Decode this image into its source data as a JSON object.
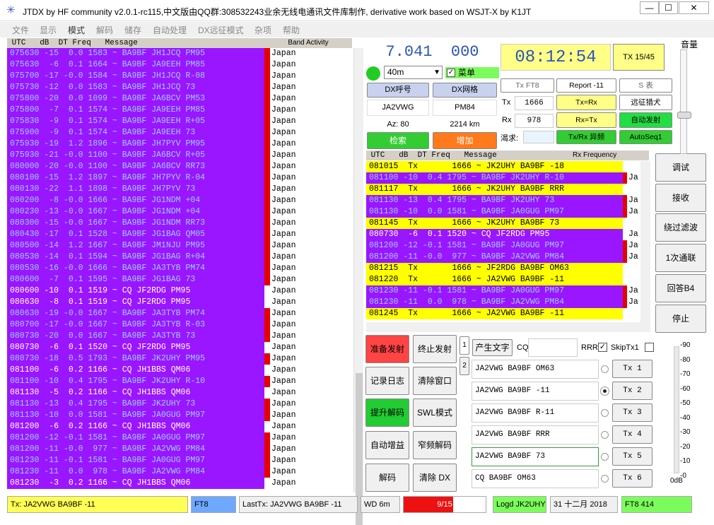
{
  "window": {
    "app_name": "JTDX",
    "title": "JTDX  by HF community         v2.0.1-rc115,中文版由QQ群:308532243业余无线电通讯文件库制作, derivative work based on WSJT-X by K1JT",
    "min_label": "—",
    "max_label": "☐",
    "close_label": "✕"
  },
  "menu": [
    "文件",
    "显示",
    "模式",
    "解码",
    "储存",
    "自动处理",
    "DX远征模式",
    "杂项",
    "帮助"
  ],
  "band_activity": {
    "header": " UTC   dB  DT Freq   Message",
    "header_right": "Band Activity",
    "colors": {
      "purple": "#9a16ff",
      "white": "#ffffff",
      "red": "#e80000",
      "text_purple": "#ffffff"
    },
    "rows": [
      {
        "t": "075630 -15  0.0 1583 ~ BA9BF JH1JCQ PM95",
        "c": "Japan",
        "bg": "purple",
        "bar": "red"
      },
      {
        "t": "075630  -6  0.1 1664 ~ BA9BF JA9EEH PM85",
        "c": "Japan",
        "bg": "purple",
        "bar": "red"
      },
      {
        "t": "075700 -17 -0.0 1584 ~ BA9BF JH1JCQ R-08",
        "c": "Japan",
        "bg": "purple",
        "bar": "red"
      },
      {
        "t": "075730 -12  0.0 1583 ~ BA9BF JH1JCQ 73",
        "c": "Japan",
        "bg": "purple",
        "bar": "red"
      },
      {
        "t": "075800 -20  0.0 1099 ~ BA9BF JA6BCV PM53",
        "c": "Japan",
        "bg": "purple",
        "bar": "red"
      },
      {
        "t": "075800  -7  0.1 1574 ~ BA9BF JA9EEH PM85",
        "c": "Japan",
        "bg": "purple",
        "bar": "red"
      },
      {
        "t": "075830  -9  0.1 1574 ~ BA9BF JA9EEH R+05",
        "c": "Japan",
        "bg": "purple",
        "bar": "red"
      },
      {
        "t": "075900  -9  0.1 1574 ~ BA9BF JA9EEH 73",
        "c": "Japan",
        "bg": "purple",
        "bar": "red"
      },
      {
        "t": "075930 -19  1.2 1896 ~ BA9BF JH7PYV PM95",
        "c": "Japan",
        "bg": "purple",
        "bar": "red"
      },
      {
        "t": "075930 -21 -0.0 1100 ~ BA9BF JA6BCV R+05",
        "c": "Japan",
        "bg": "purple",
        "bar": "red"
      },
      {
        "t": "080000 -20 -0.0 1100 ~ BA9BF JA6BCV RR73",
        "c": "Japan",
        "bg": "purple",
        "bar": "red"
      },
      {
        "t": "080100 -15  1.2 1897 ~ BA9BF JH7PYV R-04",
        "c": "Japan",
        "bg": "purple",
        "bar": "red"
      },
      {
        "t": "080130 -22  1.1 1898 ~ BA9BF JH7PYV 73",
        "c": "Japan",
        "bg": "purple",
        "bar": "red"
      },
      {
        "t": "080200  -8 -0.0 1666 ~ BA9BF JG1NDM +04",
        "c": "Japan",
        "bg": "purple",
        "bar": "red"
      },
      {
        "t": "080230 -13 -0.0 1667 ~ BA9BF JG1NDM +04",
        "c": "Japan",
        "bg": "purple",
        "bar": "red"
      },
      {
        "t": "080300 -15 -0.0 1667 ~ BA9BF JG1NDM RR73",
        "c": "Japan",
        "bg": "purple",
        "bar": "red"
      },
      {
        "t": "080430 -17  0.1 1528 ~ BA9BF JG1BAG QM05",
        "c": "Japan",
        "bg": "purple",
        "bar": "red"
      },
      {
        "t": "080500 -14  1.2 1667 ~ BA9BF JM1NJU PM95",
        "c": "Japan",
        "bg": "purple",
        "bar": "red"
      },
      {
        "t": "080530 -14  0.1 1594 ~ BA9BF JG1BAG R+04",
        "c": "Japan",
        "bg": "purple",
        "bar": "red"
      },
      {
        "t": "080530 -16 -0.0 1666 ~ BA9BF JA3TYB PM74",
        "c": "Japan",
        "bg": "purple",
        "bar": "red"
      },
      {
        "t": "080600  -7  0.1 1595 ~ BA9BF JG1BAG 73",
        "c": "Japan",
        "bg": "purple",
        "bar": "red"
      },
      {
        "t": "080600 -10  0.1 1519 ~ CQ JF2RDG PM95",
        "c": "Japan",
        "bg": "purple",
        "bar": "white"
      },
      {
        "t": "080630  -8  0.1 1519 ~ CQ JF2RDG PM95",
        "c": "Japan",
        "bg": "purple",
        "bar": "white"
      },
      {
        "t": "080630 -19 -0.0 1667 ~ BA9BF JA3TYB PM74",
        "c": "Japan",
        "bg": "purple",
        "bar": "red"
      },
      {
        "t": "080700 -17 -0.0 1667 ~ BA9BF JA3TYB R-03",
        "c": "Japan",
        "bg": "purple",
        "bar": "red"
      },
      {
        "t": "080730 -20  0.0 1667 ~ BA9BF JA3TYB 73",
        "c": "Japan",
        "bg": "purple",
        "bar": "red"
      },
      {
        "t": "080730  -6  0.1 1520 ~ CQ JF2RDG PM95",
        "c": "Japan",
        "bg": "purple",
        "bar": "white"
      },
      {
        "t": "080730 -18  0.5 1793 ~ BA9BF JK2UHY PM95",
        "c": "Japan",
        "bg": "purple",
        "bar": "red"
      },
      {
        "t": "081100  -6  0.2 1166 ~ CQ JH1BBS QM06",
        "c": "Japan",
        "bg": "purple",
        "bar": "white"
      },
      {
        "t": "081100 -10  0.4 1795 ~ BA9BF JK2UHY R-10",
        "c": "Japan",
        "bg": "purple",
        "bar": "red"
      },
      {
        "t": "081130  -5  0.2 1166 ~ CQ JH1BBS QM06",
        "c": "Japan",
        "bg": "purple",
        "bar": "white"
      },
      {
        "t": "081130 -13  0.4 1795 ~ BA9BF JK2UHY 73",
        "c": "Japan",
        "bg": "purple",
        "bar": "red"
      },
      {
        "t": "081130 -10  0.0 1581 ~ BA9BF JA0GUG PM97",
        "c": "Japan",
        "bg": "purple",
        "bar": "red"
      },
      {
        "t": "081200  -6  0.2 1166 ~ CQ JH1BBS QM06",
        "c": "Japan",
        "bg": "purple",
        "bar": "white"
      },
      {
        "t": "081200 -12 -0.1 1581 ~ BA9BF JA0GUG PM97",
        "c": "Japan",
        "bg": "purple",
        "bar": "red"
      },
      {
        "t": "081200 -11 -0.0  977 ~ BA9BF JA2VWG PM84",
        "c": "Japan",
        "bg": "purple",
        "bar": "red"
      },
      {
        "t": "081230 -11 -0.1 1581 ~ BA9BF JA0GUG PM97",
        "c": "Japan",
        "bg": "purple",
        "bar": "red"
      },
      {
        "t": "081230 -11  0.0  978 ~ BA9BF JA2VWG PM84",
        "c": "Japan",
        "bg": "purple",
        "bar": "red"
      },
      {
        "t": "081230  -3  0.2 1166 ~ CQ JH1BBS QM06",
        "c": "Japan",
        "bg": "purple",
        "bar": "white"
      }
    ]
  },
  "dial": {
    "mhz": "7.041",
    "khz": "000",
    "band": "40m",
    "menu_label": "菜单",
    "menu_checked": true
  },
  "clock": {
    "time": "08:12:54",
    "tx_label": "TX 15/45"
  },
  "dx": {
    "call_label": "DX呼号",
    "grid_label": "DX网格",
    "call": "JA2VWG",
    "grid": "PM84",
    "az": "Az: 80",
    "dist": "2214 km",
    "lookup": "检索",
    "add": "增加"
  },
  "tx_ctrl": {
    "mode": "Tx FT8",
    "report": "Report -11",
    "s_label": "S 表",
    "tx_label": "Tx",
    "tx_freq": "1666",
    "rx_label": "Rx",
    "rx_freq": "978",
    "tx_eq_rx": "Tx=Rx",
    "rx_eq_tx": "Rx=Tx",
    "swap": "Tx/Rx 异频",
    "far": "远征猎犬",
    "auto_tx": "自动发射",
    "autoseq": "AutoSeq1",
    "wish_label": "渴求:"
  },
  "rx_freq": {
    "header": " UTC   dB  DT Freq   Message",
    "header_right": "Rx Frequency",
    "colors": {
      "yellow": "#ffff00",
      "purple": "#9a16ff"
    },
    "rows": [
      {
        "t": "081015  Tx       1666 ~ JK2UHY BA9BF -18",
        "c": "",
        "bg": "yellow",
        "bar": "white"
      },
      {
        "t": "081100 -10  0.4 1795 ~ BA9BF JK2UHY R-10",
        "c": "Ja",
        "bg": "purple",
        "bar": "red"
      },
      {
        "t": "081117  Tx       1666 ~ JK2UHY BA9BF RRR",
        "c": "",
        "bg": "yellow",
        "bar": "white"
      },
      {
        "t": "081130 -13  0.4 1795 ~ BA9BF JK2UHY 73",
        "c": "Ja",
        "bg": "purple",
        "bar": "red"
      },
      {
        "t": "081130 -10  0.0 1581 ~ BA9BF JA0GUG PM97",
        "c": "Ja",
        "bg": "purple",
        "bar": "red"
      },
      {
        "t": "081145  Tx       1666 ~ JK2UHY BA9BF 73",
        "c": "",
        "bg": "yellow",
        "bar": "white"
      },
      {
        "t": "080730  -6  0.1 1520 ~ CQ JF2RDG PM95",
        "c": "Ja",
        "bg": "purple",
        "bar": "white"
      },
      {
        "t": "081200 -12 -0.1 1581 ~ BA9BF JA0GUG PM97",
        "c": "Ja",
        "bg": "purple",
        "bar": "red"
      },
      {
        "t": "081200 -11 -0.0  977 ~ BA9BF JA2VWG PM84",
        "c": "Ja",
        "bg": "purple",
        "bar": "red"
      },
      {
        "t": "081215  Tx       1666 ~ JF2RDG BA9BF OM63",
        "c": "",
        "bg": "yellow",
        "bar": "white"
      },
      {
        "t": "081220  Tx       1666 ~ JA2VWG BA9BF -11",
        "c": "",
        "bg": "yellow",
        "bar": "white"
      },
      {
        "t": "081230 -11 -0.1 1581 ~ BA9BF JA0GUG PM97",
        "c": "Ja",
        "bg": "purple",
        "bar": "red"
      },
      {
        "t": "081230 -11  0.0  978 ~ BA9BF JA2VWG PM84",
        "c": "Ja",
        "bg": "purple",
        "bar": "red"
      },
      {
        "t": "081245  Tx       1666 ~ JA2VWG BA9BF -11",
        "c": "",
        "bg": "yellow",
        "bar": "white"
      }
    ]
  },
  "actions": {
    "enable_tx": "准备发射",
    "halt_tx": "终止发射",
    "log": "记录日志",
    "clear": "清除窗口",
    "boost": "提升解码",
    "swl": "SWL模式",
    "auto_gain": "自动增益",
    "narrow": "窄频解码",
    "decode": "解码",
    "clear_dx": "清除 DX"
  },
  "messages": {
    "tab1": "1",
    "tab2": "2",
    "gen": "产生文字",
    "cq_label": "CQ",
    "rrr_label": "RRR",
    "skip_label": "SkipTx1",
    "rrr_checked": true,
    "items": [
      {
        "text": "JA2VWG BA9BF OM63",
        "btn": "Tx 1",
        "sel": false
      },
      {
        "text": "JA2VWG BA9BF -11",
        "btn": "Tx 2",
        "sel": true
      },
      {
        "text": "JA2VWG BA9BF R-11",
        "btn": "Tx 3",
        "sel": false
      },
      {
        "text": "JA2VWG BA9BF RRR",
        "btn": "Tx 4",
        "sel": false
      },
      {
        "text": "JA2VWG BA9BF 73",
        "btn": "Tx 5",
        "sel": false
      },
      {
        "text": "CQ BA9BF OM63",
        "btn": "Tx 6",
        "sel": false
      }
    ]
  },
  "side": [
    "调试",
    "接收",
    "绕过滤波",
    "1次通联",
    "回答B4",
    "停止"
  ],
  "volume": {
    "label": "音量",
    "ticks": [
      "90",
      "80",
      "70",
      "60",
      "50",
      "40",
      "30",
      "20",
      "10",
      "0"
    ],
    "top_label": "90dB",
    "unit": "0dB"
  },
  "status": {
    "tx": "Tx: JA2VWG BA9BF -11",
    "mode": "FT8",
    "last": "LastTx: JA2VWG BA9BF -11",
    "wd": "WD 6m",
    "progress": "9/15",
    "progress_frac": 0.6,
    "logd": "Logd JK2UHY",
    "date": "31 十二月 2018",
    "mode2": "FT8  414"
  }
}
